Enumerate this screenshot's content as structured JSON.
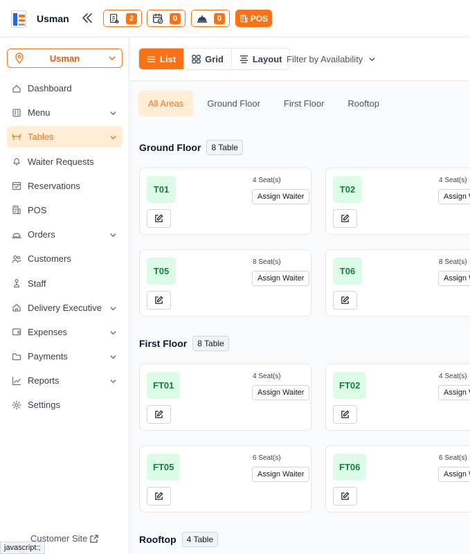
{
  "header": {
    "brand": "Usman",
    "waiter_requests_count": "2",
    "reservations_count": "0",
    "orders_count": "0",
    "pos_label": "POS"
  },
  "sidebar": {
    "branch": "Usman",
    "items": [
      {
        "label": "Dashboard",
        "icon": "home-icon",
        "chevron": false
      },
      {
        "label": "Menu",
        "icon": "menu-book-icon",
        "chevron": true
      },
      {
        "label": "Tables",
        "icon": "table-icon",
        "chevron": true,
        "active": true
      },
      {
        "label": "Waiter Requests",
        "icon": "bell-icon",
        "chevron": false
      },
      {
        "label": "Reservations",
        "icon": "calendar-check-icon",
        "chevron": false
      },
      {
        "label": "POS",
        "icon": "pos-icon",
        "chevron": false
      },
      {
        "label": "Orders",
        "icon": "cloche-icon",
        "chevron": true
      },
      {
        "label": "Customers",
        "icon": "users-icon",
        "chevron": false
      },
      {
        "label": "Staff",
        "icon": "staff-icon",
        "chevron": false
      },
      {
        "label": "Delivery Executive",
        "icon": "delivery-icon",
        "chevron": true
      },
      {
        "label": "Expenses",
        "icon": "wallet-icon",
        "chevron": true
      },
      {
        "label": "Payments",
        "icon": "folder-icon",
        "chevron": true
      },
      {
        "label": "Reports",
        "icon": "chart-line-icon",
        "chevron": true
      },
      {
        "label": "Settings",
        "icon": "gear-icon",
        "chevron": false
      }
    ],
    "customer_site": "Customer Site"
  },
  "status_bar": "javascript:;",
  "viewbar": {
    "list": "List",
    "grid": "Grid",
    "layout": "Layout",
    "filter": "Filter by Availability"
  },
  "tabs": [
    "All Areas",
    "Ground Floor",
    "First Floor",
    "Rooftop"
  ],
  "sections": [
    {
      "title": "Ground Floor",
      "badge": "8 Table",
      "tables": [
        {
          "code": "T01",
          "seats": "4 Seat(s)",
          "action": "Assign Waiter"
        },
        {
          "code": "T02",
          "seats": "4 Seat(s)",
          "action": "Assign Waiter"
        },
        {
          "code": "T05",
          "seats": "8 Seat(s)",
          "action": "Assign Waiter"
        },
        {
          "code": "T06",
          "seats": "8 Seat(s)",
          "action": "Assign Waiter"
        }
      ]
    },
    {
      "title": "First Floor",
      "badge": "8 Table",
      "tables": [
        {
          "code": "FT01",
          "seats": "4 Seat(s)",
          "action": "Assign Waiter"
        },
        {
          "code": "FT02",
          "seats": "4 Seat(s)",
          "action": "Assign Waiter"
        },
        {
          "code": "FT05",
          "seats": "6 Seat(s)",
          "action": "Assign Waiter"
        },
        {
          "code": "FT06",
          "seats": "6 Seat(s)",
          "action": "Assign Waiter"
        }
      ]
    },
    {
      "title": "Rooftop",
      "badge": "4 Table",
      "tables": []
    }
  ],
  "colors": {
    "accent": "#f97316",
    "accent_light": "#ffedd5",
    "table_bg": "#dcfce7",
    "table_text": "#15803d"
  }
}
